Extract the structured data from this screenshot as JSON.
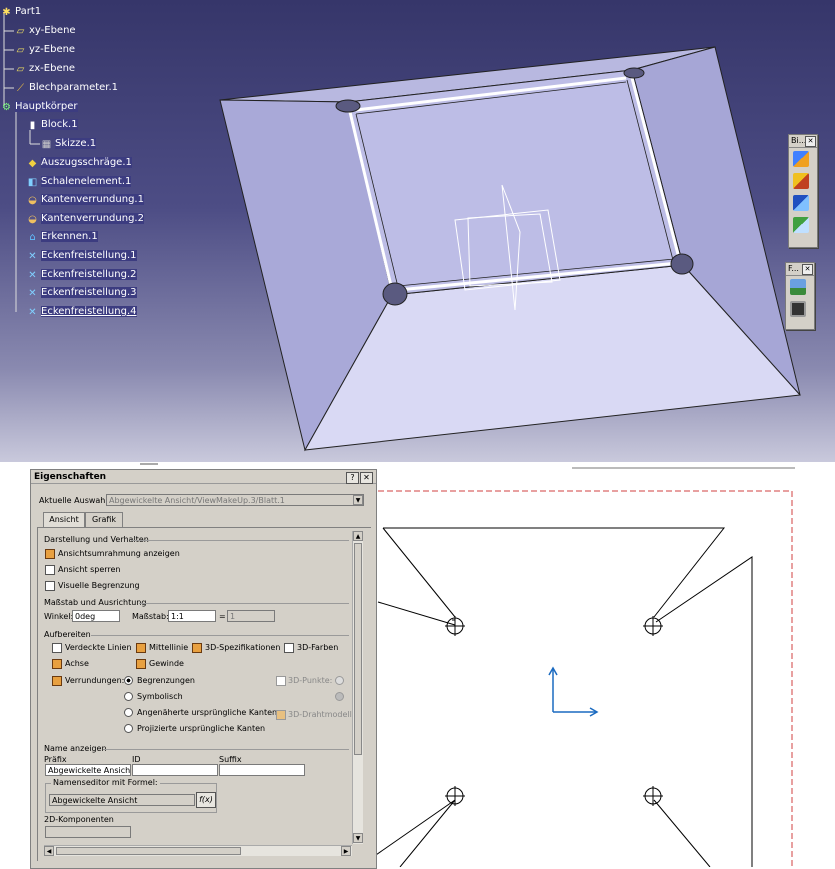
{
  "tree": {
    "items": [
      {
        "label": "Part1",
        "icon": "part-icon"
      },
      {
        "label": "xy-Ebene",
        "icon": "plane-icon"
      },
      {
        "label": "yz-Ebene",
        "icon": "plane-icon"
      },
      {
        "label": "zx-Ebene",
        "icon": "plane-icon"
      },
      {
        "label": "Blechparameter.1",
        "icon": "sheetmetal-parameters-icon"
      },
      {
        "label": "Hauptkörper",
        "icon": "body-icon"
      },
      {
        "label": "Block.1",
        "icon": "block-icon"
      },
      {
        "label": "Skizze.1",
        "icon": "sketch-icon"
      },
      {
        "label": "Auszugsschräge.1",
        "icon": "draft-icon"
      },
      {
        "label": "Schalenelement.1",
        "icon": "shell-icon"
      },
      {
        "label": "Kantenverrundung.1",
        "icon": "edge-fillet-icon"
      },
      {
        "label": "Kantenverrundung.2",
        "icon": "edge-fillet-icon"
      },
      {
        "label": "Erkennen.1",
        "icon": "recognize-icon"
      },
      {
        "label": "Eckenfreistellung.1",
        "icon": "corner-relief-icon"
      },
      {
        "label": "Eckenfreistellung.2",
        "icon": "corner-relief-icon"
      },
      {
        "label": "Eckenfreistellung.3",
        "icon": "corner-relief-icon"
      },
      {
        "label": "Eckenfreistellung.4",
        "icon": "corner-relief-icon"
      }
    ]
  },
  "toolbars": {
    "bend": {
      "title": "Bi..."
    },
    "file": {
      "title": "F..."
    }
  },
  "dialog": {
    "title": "Eigenschaften",
    "help_btn": "?",
    "close_btn": "✕",
    "current_label": "Aktuelle Auswahl:",
    "current_value": "Abgewickelte Ansicht/ViewMakeUp.3/Blatt.1",
    "tabs": [
      "Ansicht",
      "Grafik"
    ],
    "section_display": "Darstellung und Verhalten",
    "cb_frame": "Ansichtsumrahmung anzeigen",
    "cb_lock": "Ansicht sperren",
    "cb_clip": "Visuelle Begrenzung",
    "section_scale": "Maßstab und Ausrichtung",
    "angle_label": "Winkel:",
    "angle_value": "0deg",
    "scale_label": "Maßstab:",
    "scale_value": "1:1",
    "eq": "=",
    "scale_result": "1",
    "section_dress": "Aufbereiten",
    "cb_hidden": "Verdeckte Linien",
    "cb_center": "Mittellinie",
    "cb_3dspec": "3D-Spezifikationen",
    "cb_3dcolor": "3D-Farben",
    "cb_axis": "Achse",
    "cb_thread": "Gewinde",
    "cb_fillets": "Verrundungen:",
    "rb_bound": "Begrenzungen",
    "cb_3dpoints": "3D-Punkte:",
    "rb_symbolic": "Symbolisch",
    "rb_approx": "Angenäherte ursprüngliche Kanten",
    "cb_3dwire": "3D-Drahtmodell",
    "rb_projected": "Projizierte ursprüngliche Kanten",
    "section_name": "Name anzeigen",
    "col_prefix": "Präfix",
    "col_id": "ID",
    "col_suffix": "Suffix",
    "prefix_value": "Abgewickelte Ansicht",
    "id_value": "",
    "suffix_value": "",
    "section_formula": "Namenseditor mit Formel:",
    "formula_value": "Abgewickelte Ansicht",
    "fx_btn": "f(x)",
    "section_2d": "2D-Komponenten",
    "scroll_up": "▲",
    "scroll_down": "▼",
    "scroll_left": "◀",
    "scroll_right": "▶"
  }
}
